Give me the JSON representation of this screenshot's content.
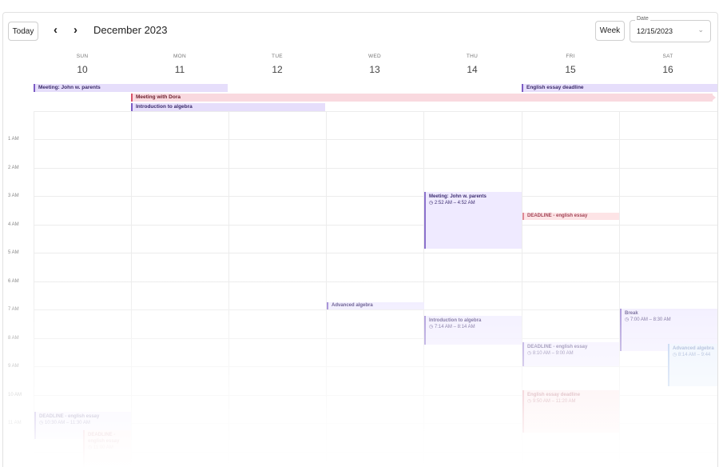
{
  "toolbar": {
    "today_label": "Today",
    "month_label": "December 2023",
    "view_label": "Week",
    "date_legend": "Date",
    "date_value": "12/15/2023",
    "prev_icon": "chevron-left-icon",
    "next_icon": "chevron-right-icon"
  },
  "days": [
    {
      "name": "SUN",
      "num": "10"
    },
    {
      "name": "MON",
      "num": "11"
    },
    {
      "name": "TUE",
      "num": "12"
    },
    {
      "name": "WED",
      "num": "13"
    },
    {
      "name": "THU",
      "num": "14"
    },
    {
      "name": "FRI",
      "num": "15"
    },
    {
      "name": "SAT",
      "num": "16"
    }
  ],
  "allday_events": [
    {
      "title": "Meeting: John w. parents"
    },
    {
      "title": "Meeting with Dora"
    },
    {
      "title": "Introduction to algebra"
    },
    {
      "title": "English essay deadline"
    }
  ],
  "hours": [
    "1 AM",
    "2 AM",
    "3 AM",
    "4 AM",
    "5 AM",
    "6 AM",
    "7 AM",
    "8 AM",
    "9 AM",
    "10 AM",
    "11 AM"
  ],
  "events": [
    {
      "title": "Meeting: John w. parents",
      "time": "2:52 AM – 4:52 AM"
    },
    {
      "title": "DEADLINE - english essay",
      "time": ""
    },
    {
      "title": "Advanced algebra",
      "time": ""
    },
    {
      "title": "Introduction to algebra",
      "time": "7:14 AM – 8:14 AM"
    },
    {
      "title": "Break",
      "time": "7:00 AM – 8:30 AM"
    },
    {
      "title": "DEADLINE - english essay",
      "time": "8:10 AM – 9:00 AM"
    },
    {
      "title": "Advanced algebra",
      "time": "8:14 AM – 9:44"
    },
    {
      "title": "English essay deadline",
      "time": "9:50 AM – 11:20 AM"
    },
    {
      "title": "DEADLINE - english essay",
      "time": "10:30 AM – 11:30 AM"
    },
    {
      "title": "DEADLINE - english essay",
      "time": "11:00 AM"
    }
  ],
  "colors": {
    "purple_accent": "#7c5cc4",
    "pink_accent": "#d9536a"
  }
}
